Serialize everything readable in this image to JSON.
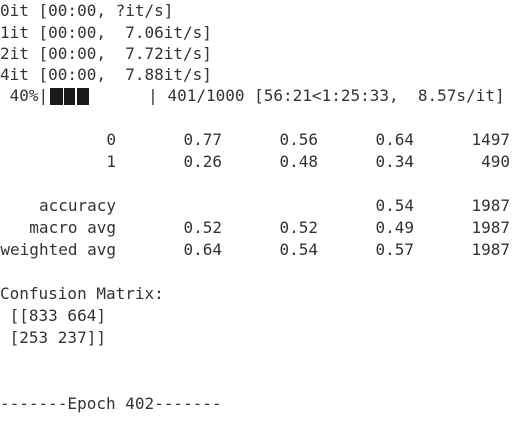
{
  "log_lines": [
    "0it [00:00, ?it/s]",
    "1it [00:00,  7.06it/s]",
    "2it [00:00,  7.72it/s]",
    "4it [00:00,  7.88it/s]"
  ],
  "progress": {
    "percent_label": " 40%|",
    "fraction": 0.4,
    "suffix": "| 401/1000 [56:21<1:25:33,  8.57s/it]"
  },
  "report": {
    "class_rows": [
      {
        "label": "0",
        "precision": "0.77",
        "recall": "0.56",
        "f1": "0.64",
        "support": "1497"
      },
      {
        "label": "1",
        "precision": "0.26",
        "recall": "0.48",
        "f1": "0.34",
        "support": "490"
      }
    ],
    "summary_rows": [
      {
        "label": "accuracy",
        "precision": "",
        "recall": "",
        "f1": "0.54",
        "support": "1987"
      },
      {
        "label": "macro avg",
        "precision": "0.52",
        "recall": "0.52",
        "f1": "0.49",
        "support": "1987"
      },
      {
        "label": "weighted avg",
        "precision": "0.64",
        "recall": "0.54",
        "f1": "0.57",
        "support": "1987"
      }
    ]
  },
  "confusion": {
    "title": "Confusion Matrix:",
    "row1": " [[833 664]",
    "row2": " [253 237]]"
  },
  "epoch_line": "-------Epoch 402-------"
}
